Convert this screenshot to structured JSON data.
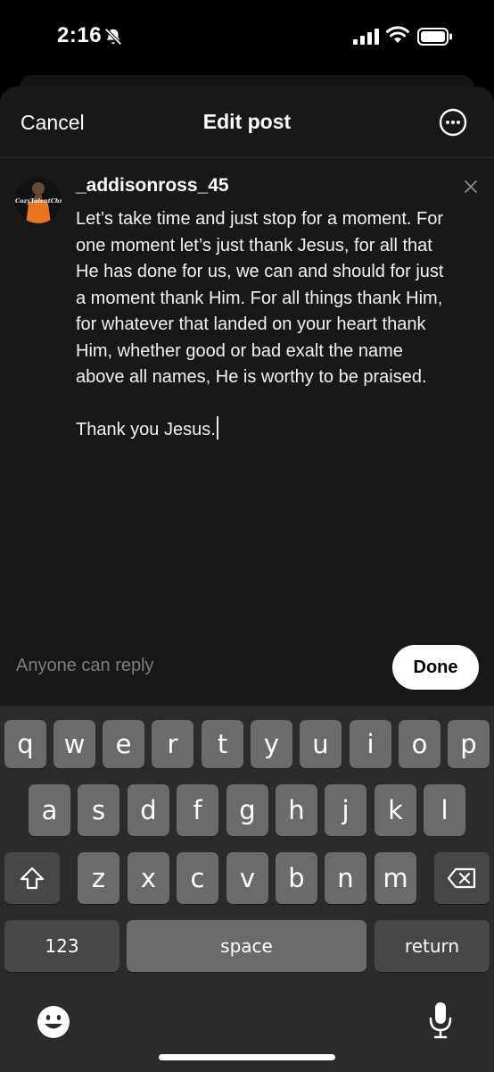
{
  "status_bar": {
    "time": "2:16",
    "icons": [
      "bell-slash-icon",
      "cellular-signal-icon",
      "wifi-icon",
      "battery-icon"
    ]
  },
  "header": {
    "cancel_label": "Cancel",
    "title": "Edit post",
    "more_icon": "ellipsis-circle-icon"
  },
  "post": {
    "avatar_text": "CozyTalentChrist",
    "username": "_addisonross_45",
    "body": "Let’s take time and just stop for a moment. For\none moment let’s just thank Jesus, for all that\nHe has done for us, we can and should for just\na moment thank Him. For all things thank Him,\nfor whatever that landed on your heart thank\nHim, whether good or bad exalt the name\nabove all names, He is worthy to be praised.",
    "closing": "Thank you Jesus."
  },
  "footer": {
    "reply_setting": "Anyone can reply",
    "done_label": "Done"
  },
  "keyboard": {
    "row1": [
      "q",
      "w",
      "e",
      "r",
      "t",
      "y",
      "u",
      "i",
      "o",
      "p"
    ],
    "row2": [
      "a",
      "s",
      "d",
      "f",
      "g",
      "h",
      "j",
      "k",
      "l"
    ],
    "row3": [
      "z",
      "x",
      "c",
      "v",
      "b",
      "n",
      "m"
    ],
    "numbers_key": "123",
    "space_key": "space",
    "return_key": "return",
    "icons": [
      "shift-icon",
      "backspace-icon",
      "emoji-icon",
      "microphone-icon"
    ]
  },
  "colors": {
    "sheet_background": "#181818",
    "keyboard_background": "#2b2b2b",
    "key_light": "#6b6b6b",
    "key_dark": "#474747"
  }
}
